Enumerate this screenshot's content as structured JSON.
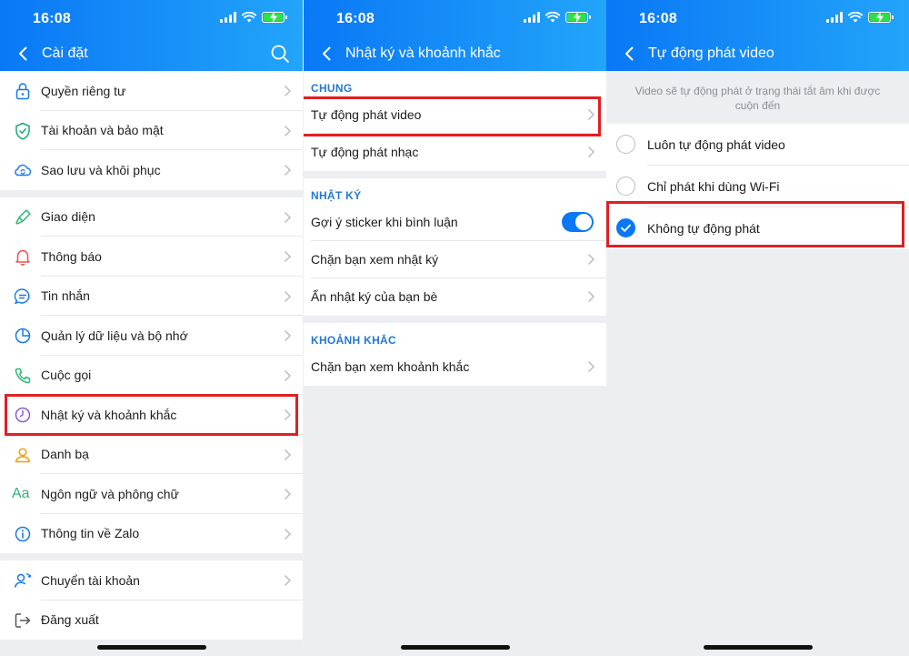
{
  "status": {
    "time": "16:08"
  },
  "panel1": {
    "title": "Cài đặt",
    "groups": [
      [
        {
          "label": "Quyền riêng tư",
          "icon": "lock-icon"
        },
        {
          "label": "Tài khoản và bảo mật",
          "icon": "shield-icon"
        },
        {
          "label": "Sao lưu và khôi phục",
          "icon": "cloud-sync-icon"
        }
      ],
      [
        {
          "label": "Giao diện",
          "icon": "paint-brush-icon"
        },
        {
          "label": "Thông báo",
          "icon": "bell-icon"
        },
        {
          "label": "Tin nhắn",
          "icon": "chat-icon"
        },
        {
          "label": "Quản lý dữ liệu và bộ nhớ",
          "icon": "pie-chart-icon"
        },
        {
          "label": "Cuộc gọi",
          "icon": "phone-icon"
        },
        {
          "label": "Nhật ký và khoảnh khắc",
          "icon": "clock-icon"
        },
        {
          "label": "Danh bạ",
          "icon": "contact-icon"
        },
        {
          "label": "Ngôn ngữ và phông chữ",
          "icon": "font-icon"
        },
        {
          "label": "Thông tin về Zalo",
          "icon": "info-icon"
        }
      ],
      [
        {
          "label": "Chuyển tài khoản",
          "icon": "switch-account-icon"
        },
        {
          "label": "Đăng xuất",
          "icon": "logout-icon"
        }
      ]
    ],
    "font_icon_text": "Aa"
  },
  "panel2": {
    "title": "Nhật ký và khoảnh khắc",
    "sections": [
      {
        "header": "CHUNG",
        "items": [
          "Tự động phát video",
          "Tự động phát nhạc"
        ]
      },
      {
        "header": "NHẬT KÝ",
        "items": [
          "Gợi ý sticker khi bình luận",
          "Chặn bạn xem nhật ký",
          "Ẩn nhật ký của bạn bè"
        ]
      },
      {
        "header": "KHOẢNH KHẮC",
        "items": [
          "Chặn bạn xem khoảnh khắc"
        ]
      }
    ],
    "sticker_toggle_on": true
  },
  "panel3": {
    "title": "Tự động phát video",
    "description": "Video sẽ tự động phát ở trạng thái tắt âm khi được cuộn đến",
    "options": [
      "Luôn tự động phát video",
      "Chỉ phát khi dùng Wi-Fi",
      "Không tự động phát"
    ],
    "selected_index": 2
  },
  "colors": {
    "header_blue": "#0a78f6",
    "highlight_red": "#e01f22",
    "section_blue": "#2379d0"
  }
}
